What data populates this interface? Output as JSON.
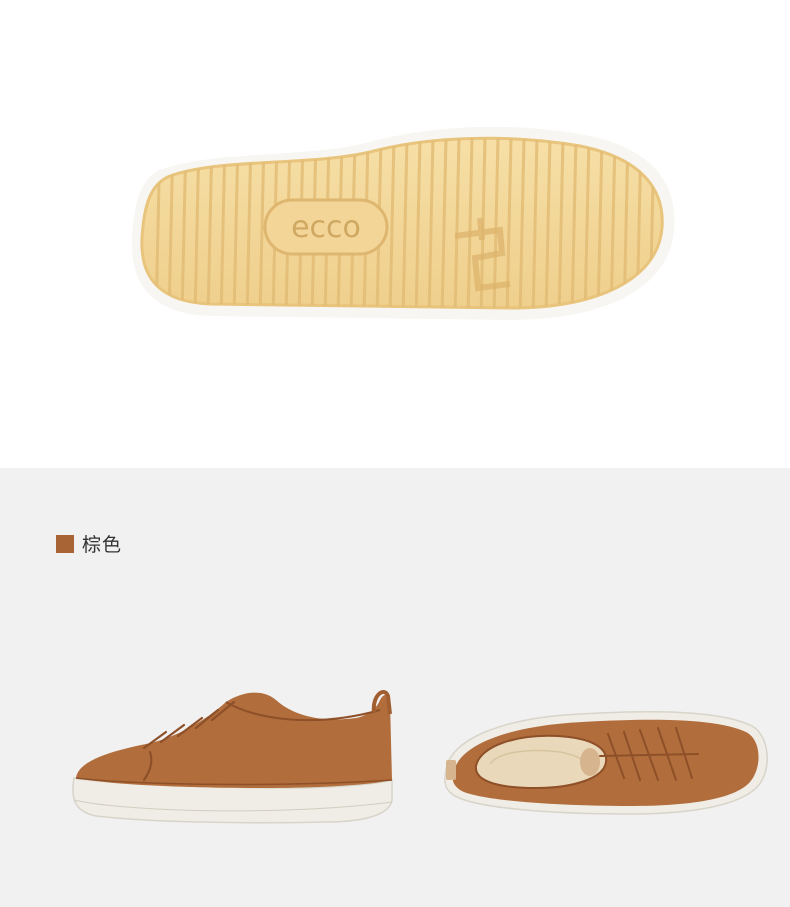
{
  "sole_image": {
    "logo_text": "ecco",
    "alt": "shoe-outsole"
  },
  "color_option": {
    "swatch_color": "#a96436",
    "label": "棕色"
  },
  "product_images": {
    "side_view": "side-view",
    "top_view": "top-view"
  },
  "colors": {
    "leather": "#b26d3c",
    "leather_dark": "#8e5028",
    "sole_white": "#efede6",
    "outsole_gum": "#f3d597",
    "background_grey": "#f1f1f1"
  }
}
